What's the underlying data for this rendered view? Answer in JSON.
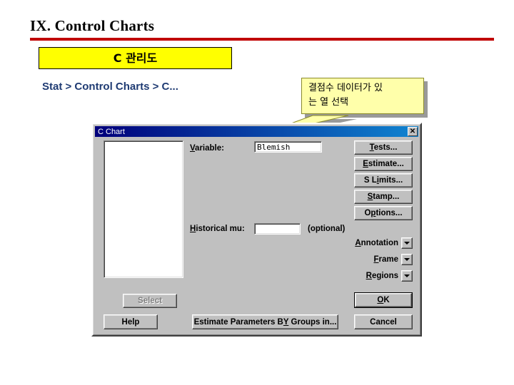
{
  "slide": {
    "title": "IX. Control Charts",
    "rule_color": "#C00000",
    "heading_box": {
      "text": "C 관리도",
      "background": "#FFFF00"
    },
    "menu_path": "Stat > Control Charts > C...",
    "menu_path_color": "#1F3B73",
    "callout": {
      "line1": "결점수 데이터가 있",
      "line2": "는 열 선택",
      "background": "#FFFFAA"
    }
  },
  "dialog": {
    "title": "C Chart",
    "close_icon": "✕",
    "titlebar_gradient_start": "#00007B",
    "titlebar_gradient_end": "#1084D0",
    "face_color": "#C0C0C0",
    "variable": {
      "label": "Variable:",
      "value": "Blemish",
      "placeholder": ""
    },
    "historical_mu": {
      "label": "Historical mu:",
      "value": "",
      "placeholder": "",
      "optional_note": "(optional)"
    },
    "select_button": {
      "label": "Select",
      "enabled": false
    },
    "help_button": {
      "label": "Help"
    },
    "estimate_groups_button": {
      "label": "Estimate Parameters BY Groups in..."
    },
    "right_buttons": [
      {
        "label": "Tests..."
      },
      {
        "label": "Estimate..."
      },
      {
        "label": "S Limits..."
      },
      {
        "label": "Stamp..."
      },
      {
        "label": "Options..."
      }
    ],
    "dropdowns": [
      {
        "label": "Annotation"
      },
      {
        "label": "Frame"
      },
      {
        "label": "Regions"
      }
    ],
    "ok_button": {
      "label": "OK"
    },
    "cancel_button": {
      "label": "Cancel"
    },
    "variable_list": []
  }
}
